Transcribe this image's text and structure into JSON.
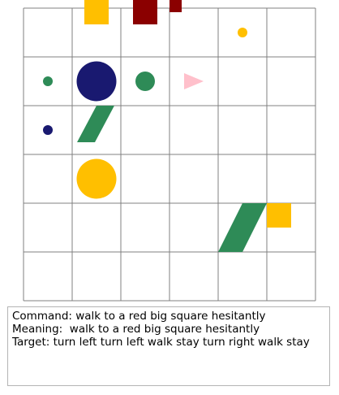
{
  "board": {
    "rows": 6,
    "cols": 6,
    "grid_color": "#808080",
    "background": "#ffffff",
    "objects": [
      {
        "name": "yellow-square",
        "shape": "square",
        "color": "#FFBF00",
        "row": 0,
        "col": 1,
        "size": "big",
        "clipped": true
      },
      {
        "name": "red-square",
        "shape": "square",
        "color": "#8B0000",
        "row": 0,
        "col": 2,
        "size": "big",
        "clipped": true
      },
      {
        "name": "red-square",
        "shape": "square",
        "color": "#8B0000",
        "row": 0,
        "col": 3,
        "size": "small",
        "clipped": true
      },
      {
        "name": "yellow-circle",
        "shape": "circle",
        "color": "#FFBF00",
        "row": 0,
        "col": 4,
        "size": "small"
      },
      {
        "name": "green-circle",
        "shape": "circle",
        "color": "#2E8B57",
        "row": 1,
        "col": 0,
        "size": "small"
      },
      {
        "name": "blue-circle",
        "shape": "circle",
        "color": "#191970",
        "row": 1,
        "col": 1,
        "size": "big"
      },
      {
        "name": "green-circle",
        "shape": "circle",
        "color": "#2E8B57",
        "row": 1,
        "col": 2,
        "size": "medium"
      },
      {
        "name": "agent-triangle",
        "shape": "triangle",
        "color": "#FFC0CB",
        "row": 1,
        "col": 3,
        "size": "medium",
        "direction": "east"
      },
      {
        "name": "blue-circle",
        "shape": "circle",
        "color": "#191970",
        "row": 2,
        "col": 0,
        "size": "small"
      },
      {
        "name": "green-cylinder",
        "shape": "cylinder",
        "color": "#2E8B57",
        "row": 2,
        "col": 1,
        "size": "medium"
      },
      {
        "name": "yellow-circle",
        "shape": "circle",
        "color": "#FFBF00",
        "row": 3,
        "col": 1,
        "size": "big"
      },
      {
        "name": "green-cylinder",
        "shape": "cylinder",
        "color": "#2E8B57",
        "row": 4,
        "col": 4,
        "size": "big"
      },
      {
        "name": "yellow-square",
        "shape": "square",
        "color": "#FFBF00",
        "row": 4,
        "col": 5,
        "size": "medium"
      }
    ]
  },
  "info": {
    "command": "Command: walk to a red big square hesitantly",
    "meaning": "Meaning:  walk to a red big square hesitantly",
    "target": "Target: turn left turn left walk stay turn right walk stay"
  }
}
